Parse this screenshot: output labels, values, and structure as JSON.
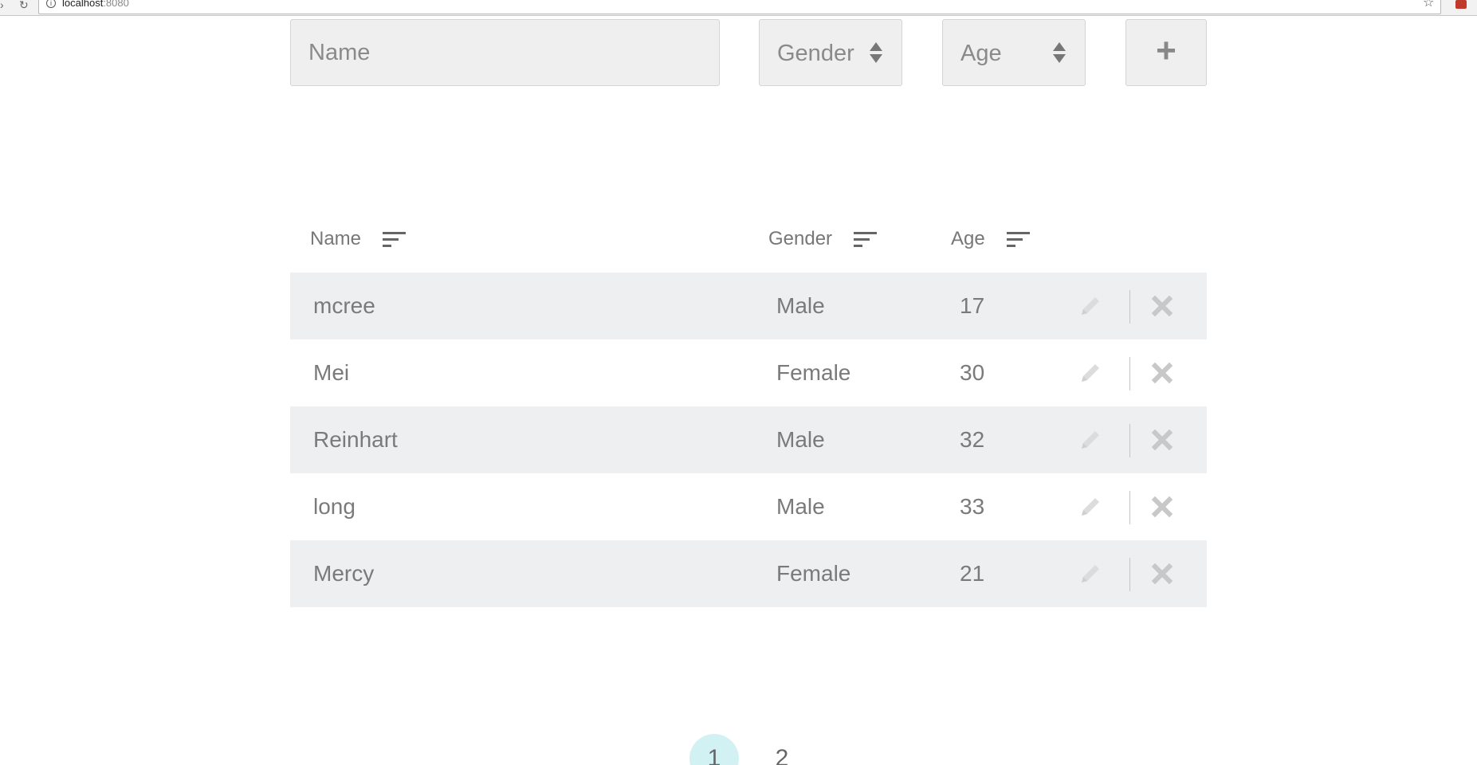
{
  "browser": {
    "url_host": "localhost",
    "url_port": ":8080"
  },
  "form": {
    "name_placeholder": "Name",
    "gender_label": "Gender",
    "age_label": "Age",
    "add_label": "+"
  },
  "table": {
    "headers": {
      "name": "Name",
      "gender": "Gender",
      "age": "Age"
    },
    "rows": [
      {
        "name": "mcree",
        "gender": "Male",
        "age": "17"
      },
      {
        "name": "Mei",
        "gender": "Female",
        "age": "30"
      },
      {
        "name": "Reinhart",
        "gender": "Male",
        "age": "32"
      },
      {
        "name": "long",
        "gender": "Male",
        "age": "33"
      },
      {
        "name": "Mercy",
        "gender": "Female",
        "age": "21"
      }
    ],
    "row_actions": {
      "edit_icon": "pencil-icon",
      "delete_icon": "close-icon"
    },
    "row_colors": {
      "odd": "#eeeff0",
      "even": "#ffffff"
    }
  },
  "pagination": {
    "pages": [
      "1",
      "2"
    ],
    "active_page": "1",
    "active_color": "#d2f1f3"
  }
}
